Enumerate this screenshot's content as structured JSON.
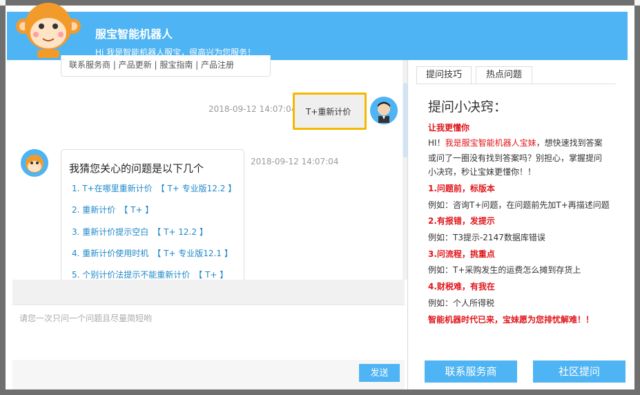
{
  "colors": {
    "accent": "#4fb4f3",
    "highlight": "#f5b800",
    "red": "#e0161b",
    "link": "#1e88c9"
  },
  "header": {
    "title": "服宝智能机器人",
    "subtitle": "Hi 我是智能机器人服宝，很高兴为您服务！"
  },
  "previous_links": "联系服务商  |  产品更新  |  服宝指南  |  产品注册",
  "messages": {
    "user": {
      "time": "2018-09-12 14:07:04",
      "text": "T+重新计价"
    },
    "bot": {
      "time": "2018-09-12 14:07:04",
      "title": "我猜您关心的问题是以下几个",
      "answers": [
        {
          "label": "1. T+在哪里重新计价",
          "tag": "【 T+ 专业版12.2 】"
        },
        {
          "label": "2. 重新计价",
          "tag": "【 T+ 】"
        },
        {
          "label": "3. 重新计价提示空白",
          "tag": "【 T+ 12.2 】"
        },
        {
          "label": "4. 重新计价使用时机",
          "tag": "【 T+ 专业版12.1 】"
        },
        {
          "label": "5. 个别计价法提示不能重新计价",
          "tag": "【 T+ 】"
        }
      ]
    }
  },
  "input": {
    "placeholder": "请您一次只问一个问题且尽量简短哟"
  },
  "send_label": "发送",
  "tabs": [
    "提问技巧",
    "热点问题"
  ],
  "tips": {
    "title": "提问小决窍：",
    "heading": "让我更懂你",
    "intro_a": "HI！",
    "intro_red": "我是服宝智能机器人宝妹",
    "intro_b": "，想快速找到答案",
    "intro2": "或问了一圈没有找到答案吗？别担心，掌握提问",
    "intro3": "小决窍，秒让宝妹更懂你！！",
    "items": [
      {
        "head": "1.问题前，标版本",
        "example": "例如：咨询T+问题，在问题前先加T+再描述问题"
      },
      {
        "head": "2.有报错，发提示",
        "example": "例如：T3提示-2147数据库错误"
      },
      {
        "head": "3.问流程，挑重点",
        "example": "例如：T+采购发生的运费怎么摊到存货上"
      },
      {
        "head": "4.财税难，有我在",
        "example": "例如：个人所得税"
      }
    ],
    "closing": "智能机器时代已来，宝妹愿为您排忧解难！！"
  },
  "footer": {
    "contact": "联系服务商",
    "community": "社区提问"
  }
}
